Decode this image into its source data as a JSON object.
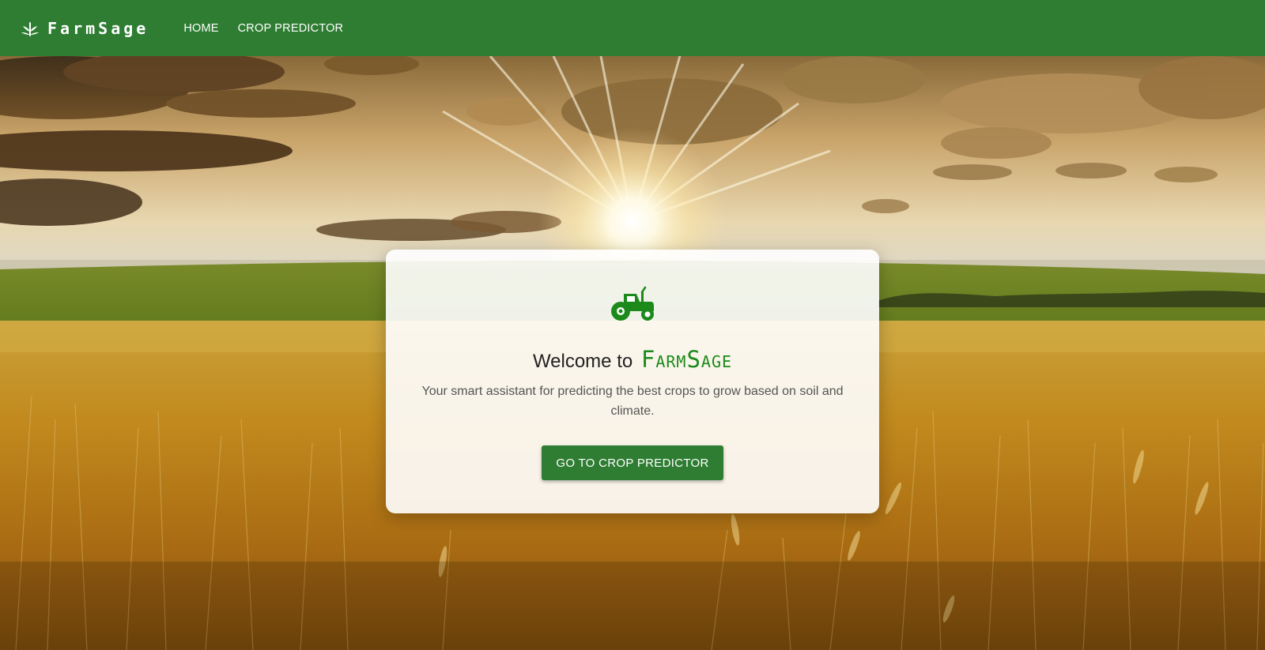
{
  "navbar": {
    "brand_name": "FarmSage",
    "brand_icon": "sprout-icon",
    "links": [
      "HOME",
      "CROP PREDICTOR"
    ]
  },
  "hero": {
    "background": "sunrise-wheat-field-image"
  },
  "card": {
    "icon": "tractor-icon",
    "title_prefix": "Welcome to",
    "title_brand": "FarmSage",
    "description": "Your smart assistant for predicting the best crops to grow based on soil and climate.",
    "button_label": "GO TO CROP PREDICTOR"
  },
  "colors": {
    "navbar": "#2e7d32",
    "accent_green": "#1b8a1b",
    "button": "#2e7d32"
  }
}
